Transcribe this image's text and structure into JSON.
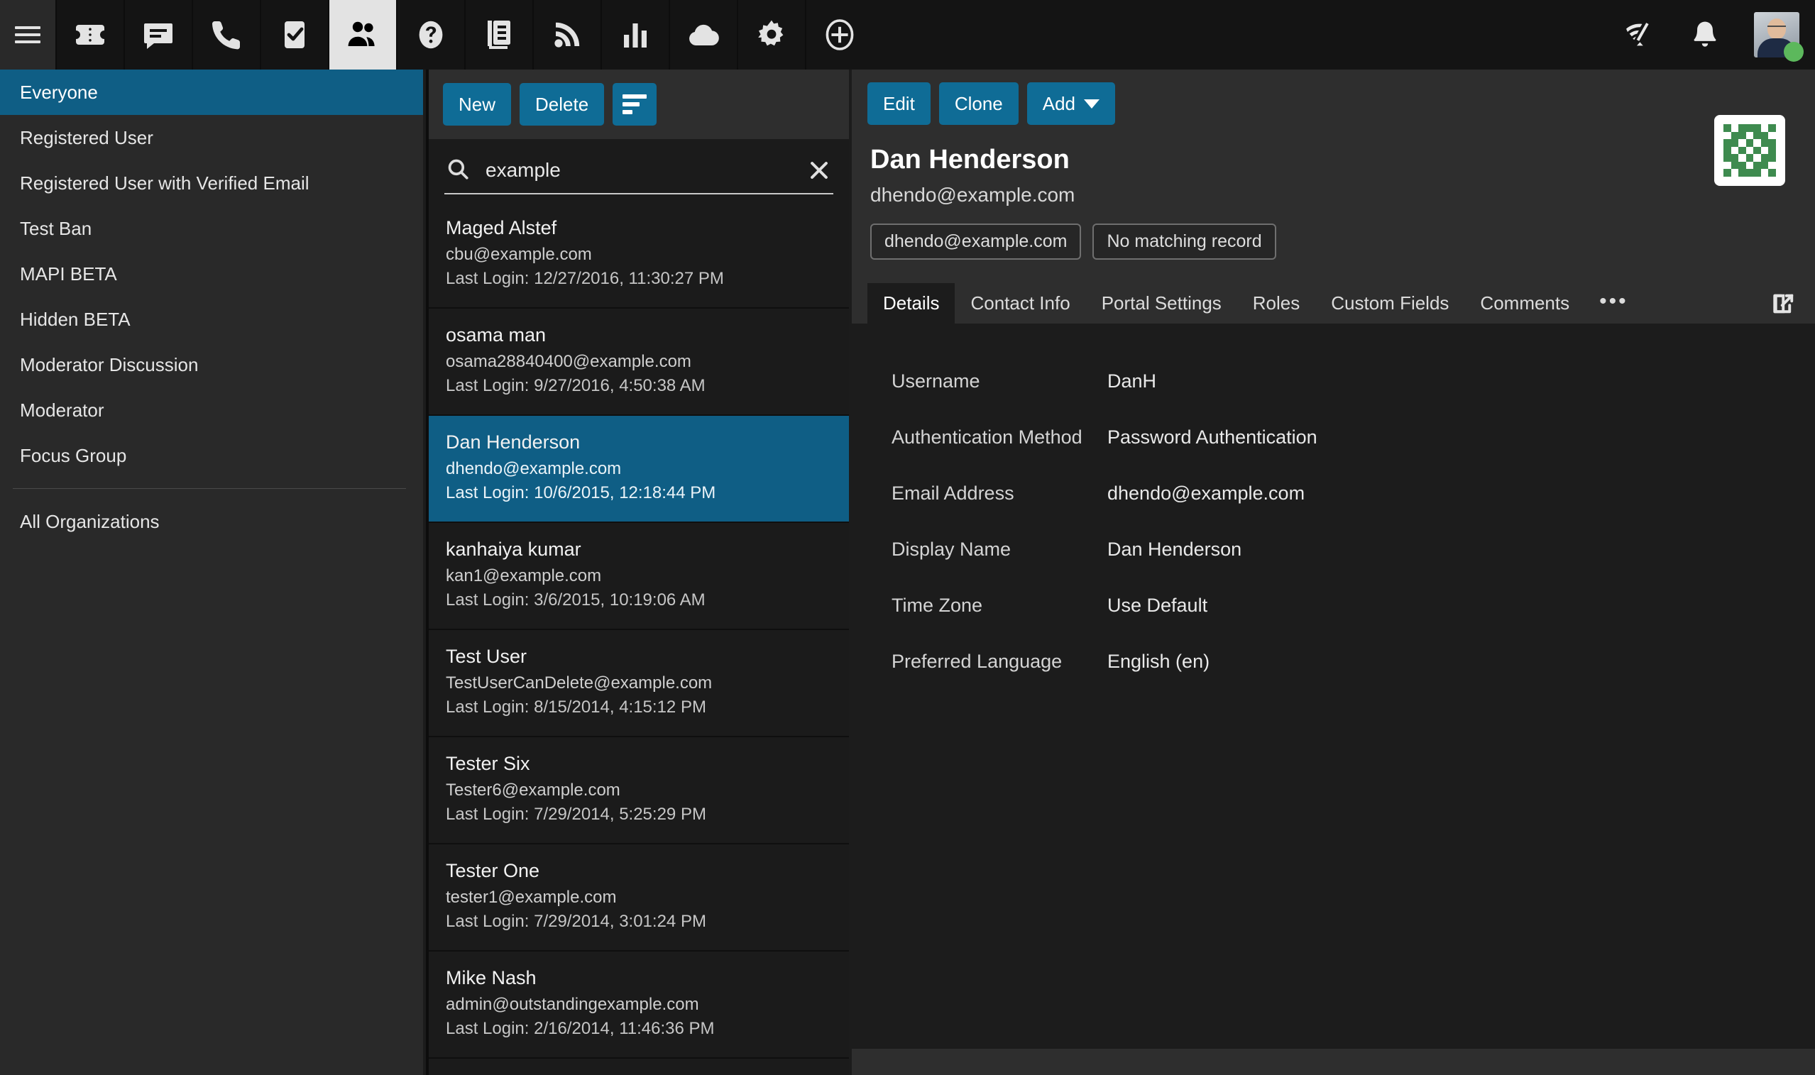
{
  "topnav": {
    "hamburger_label": "menu-icon",
    "icons": [
      {
        "name": "ticket-icon",
        "label": "Tickets",
        "active": false
      },
      {
        "name": "chat-icon",
        "label": "Chat",
        "active": false
      },
      {
        "name": "phone-icon",
        "label": "Calls",
        "active": false
      },
      {
        "name": "tasks-icon",
        "label": "Tasks",
        "active": false
      },
      {
        "name": "people-icon",
        "label": "Users",
        "active": true
      },
      {
        "name": "help-icon",
        "label": "Help",
        "active": false
      },
      {
        "name": "documents-icon",
        "label": "Documents",
        "active": false
      },
      {
        "name": "rss-icon",
        "label": "Feeds",
        "active": false
      },
      {
        "name": "chart-icon",
        "label": "Reports",
        "active": false
      },
      {
        "name": "cloud-icon",
        "label": "Cloud",
        "active": false
      },
      {
        "name": "gear-icon",
        "label": "Settings",
        "active": false
      },
      {
        "name": "plus-circle-icon",
        "label": "Add",
        "active": false
      }
    ],
    "right_icons": [
      {
        "name": "connection-icon",
        "label": "Connection"
      },
      {
        "name": "bell-icon",
        "label": "Notifications"
      }
    ],
    "avatar": {
      "name": "user-avatar",
      "status": "online",
      "status_color": "#5cb85c"
    }
  },
  "sidebar": {
    "items": [
      {
        "label": "Everyone",
        "selected": true
      },
      {
        "label": "Registered User",
        "selected": false
      },
      {
        "label": "Registered User with Verified Email",
        "selected": false
      },
      {
        "label": "Test Ban",
        "selected": false
      },
      {
        "label": "MAPI BETA",
        "selected": false
      },
      {
        "label": "Hidden BETA",
        "selected": false
      },
      {
        "label": "Moderator Discussion",
        "selected": false
      },
      {
        "label": "Moderator",
        "selected": false
      },
      {
        "label": "Focus Group",
        "selected": false
      }
    ],
    "footer_items": [
      {
        "label": "All Organizations",
        "selected": false
      }
    ]
  },
  "list_panel": {
    "toolbar": {
      "new_label": "New",
      "delete_label": "Delete",
      "sort_icon": "sort-icon"
    },
    "search": {
      "value": "example",
      "placeholder": "Search",
      "icon": "search-icon",
      "clear_icon": "close-icon"
    },
    "items": [
      {
        "name": "Maged Alstef",
        "email": "cbu@example.com",
        "last_login": "Last Login: 12/27/2016, 11:30:27 PM",
        "selected": false
      },
      {
        "name": "osama man",
        "email": "osama28840400@example.com",
        "last_login": "Last Login: 9/27/2016, 4:50:38 AM",
        "selected": false
      },
      {
        "name": "Dan Henderson",
        "email": "dhendo@example.com",
        "last_login": "Last Login: 10/6/2015, 12:18:44 PM",
        "selected": true
      },
      {
        "name": "kanhaiya kumar",
        "email": "kan1@example.com",
        "last_login": "Last Login: 3/6/2015, 10:19:06 AM",
        "selected": false
      },
      {
        "name": "Test User",
        "email": "TestUserCanDelete@example.com",
        "last_login": "Last Login: 8/15/2014, 4:15:12 PM",
        "selected": false
      },
      {
        "name": "Tester Six",
        "email": "Tester6@example.com",
        "last_login": "Last Login: 7/29/2014, 5:25:29 PM",
        "selected": false
      },
      {
        "name": "Tester One",
        "email": "tester1@example.com",
        "last_login": "Last Login: 7/29/2014, 3:01:24 PM",
        "selected": false
      },
      {
        "name": "Mike Nash",
        "email": "admin@outstandingexample.com",
        "last_login": "Last Login: 2/16/2014, 11:46:36 PM",
        "selected": false
      }
    ]
  },
  "detail": {
    "toolbar": {
      "edit_label": "Edit",
      "clone_label": "Clone",
      "add_label": "Add",
      "add_caret_icon": "chevron-down-icon"
    },
    "title": "Dan Henderson",
    "subtitle": "dhendo@example.com",
    "identicon_name": "identicon-avatar",
    "badges": [
      {
        "label": "dhendo@example.com"
      },
      {
        "label": "No matching record"
      }
    ],
    "tabs": [
      {
        "label": "Details",
        "active": true
      },
      {
        "label": "Contact Info",
        "active": false
      },
      {
        "label": "Portal Settings",
        "active": false
      },
      {
        "label": "Roles",
        "active": false
      },
      {
        "label": "Custom Fields",
        "active": false
      },
      {
        "label": "Comments",
        "active": false
      }
    ],
    "tab_more_label": "•••",
    "popout_icon": "external-link-icon",
    "fields": [
      {
        "label": "Username",
        "value": "DanH"
      },
      {
        "label": "Authentication Method",
        "value": "Password Authentication"
      },
      {
        "label": "Email Address",
        "value": "dhendo@example.com"
      },
      {
        "label": "Display Name",
        "value": "Dan Henderson"
      },
      {
        "label": "Time Zone",
        "value": "Use Default"
      },
      {
        "label": "Preferred Language",
        "value": "English (en)"
      }
    ]
  },
  "colors": {
    "accent": "#0f6c96",
    "selection": "#0f5e85",
    "nav_bg": "#141414",
    "sidebar_bg": "#292929",
    "panel_bg": "#1c1c1c",
    "status_online": "#5cb85c",
    "identicon_green": "#3e8b4f"
  }
}
